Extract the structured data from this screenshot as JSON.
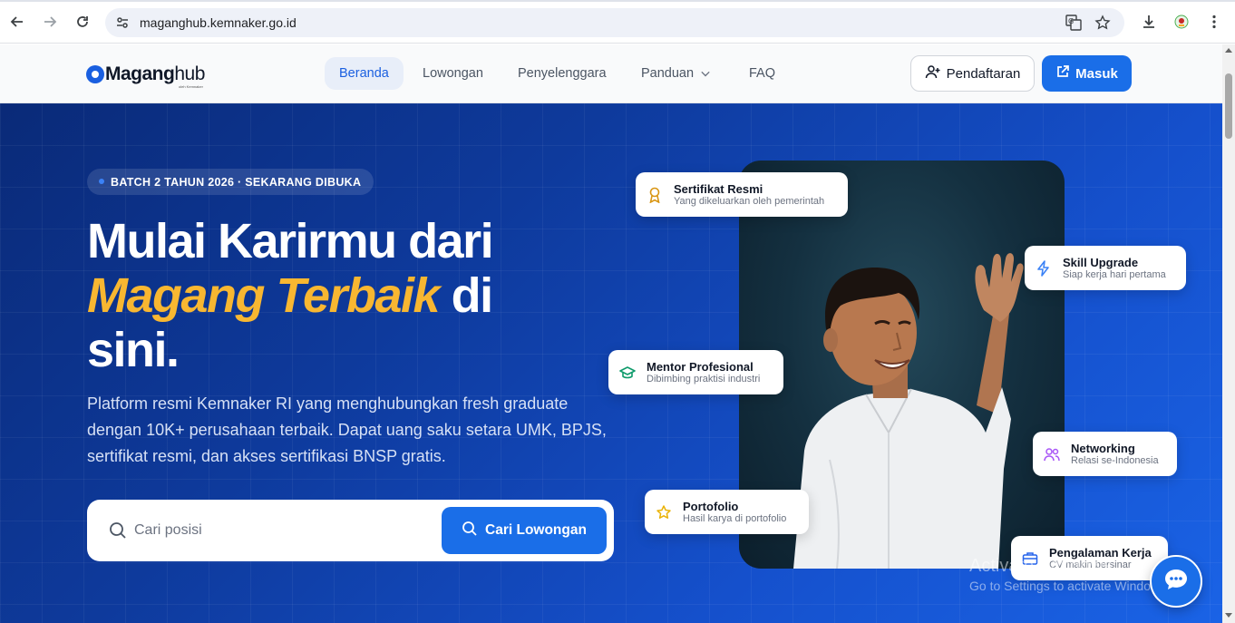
{
  "browser": {
    "url": "maganghub.kemnaker.go.id",
    "icons": [
      "back-icon",
      "forward-icon",
      "reload-icon",
      "site-info-icon",
      "translate-icon",
      "bookmark-star-icon",
      "download-icon",
      "extension-icon",
      "menu-kebab-icon"
    ]
  },
  "header": {
    "logo_bold": "Magang",
    "logo_light": "hub",
    "logo_sub": "oleh Kemnaker",
    "nav": [
      {
        "label": "Beranda",
        "active": true
      },
      {
        "label": "Lowongan"
      },
      {
        "label": "Penyelenggara"
      },
      {
        "label": "Panduan"
      },
      {
        "label": "FAQ"
      }
    ],
    "register_label": "Pendaftaran",
    "login_label": "Masuk"
  },
  "hero": {
    "badge": "BATCH 2 TAHUN 2026 · SEKARANG DIBUKA",
    "headline_1": "Mulai Karirmu dari",
    "headline_highlight": "Magang Terbaik",
    "headline_2": " di",
    "headline_3": "sini.",
    "description": "Platform resmi Kemnaker RI yang menghubungkan fresh graduate dengan 10K+ perusahaan terbaik. Dapat uang saku setara UMK, BPJS, sertifikat resmi, dan akses sertifikasi BNSP gratis.",
    "search_placeholder": "Cari posisi",
    "search_button": "Cari Lowongan"
  },
  "features": [
    {
      "title": "Sertifikat Resmi",
      "subtitle": "Yang dikeluarkan oleh pemerintah",
      "icon": "award-icon"
    },
    {
      "title": "Skill Upgrade",
      "subtitle": "Siap kerja hari pertama",
      "icon": "lightning-icon"
    },
    {
      "title": "Mentor Profesional",
      "subtitle": "Dibimbing praktisi industri",
      "icon": "graduation-cap-icon"
    },
    {
      "title": "Networking",
      "subtitle": "Relasi se-Indonesia",
      "icon": "users-icon"
    },
    {
      "title": "Portofolio",
      "subtitle": "Hasil karya di portofolio",
      "icon": "star-icon"
    },
    {
      "title": "Pengalaman Kerja",
      "subtitle": "CV makin bersinar",
      "icon": "briefcase-icon"
    }
  ],
  "watermark": {
    "line1": "Activate Windows",
    "line2": "Go to Settings to activate Windows."
  },
  "colors": {
    "primary": "#1a6ee8",
    "highlight": "#f8b731",
    "hero_dark": "#0a2a78"
  }
}
